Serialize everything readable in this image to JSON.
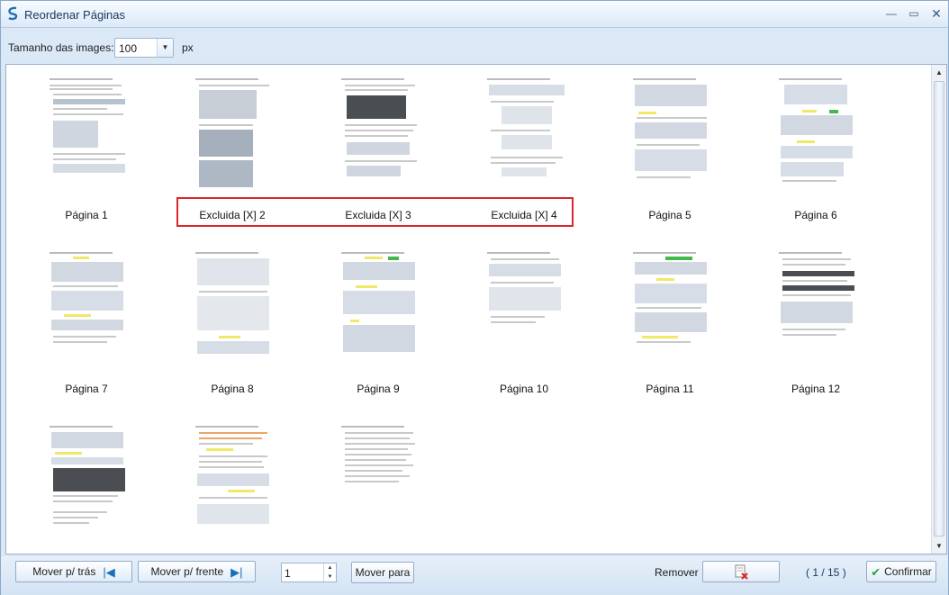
{
  "window": {
    "title": "Reordenar Páginas",
    "controls": {
      "minimize": "—",
      "maximize": "▭",
      "close": "✕"
    }
  },
  "toolbar": {
    "size_label": "Tamanho das images:",
    "size_value": "100",
    "size_unit": "px"
  },
  "pages": [
    {
      "label": "Página 1"
    },
    {
      "label": "Excluida [X] 2"
    },
    {
      "label": "Excluida [X] 3"
    },
    {
      "label": "Excluida [X] 4"
    },
    {
      "label": "Página 5"
    },
    {
      "label": "Página 6"
    },
    {
      "label": "Página 7"
    },
    {
      "label": "Página 8"
    },
    {
      "label": "Página 9"
    },
    {
      "label": "Página 10"
    },
    {
      "label": "Página 11"
    },
    {
      "label": "Página 12"
    },
    {
      "label": ""
    },
    {
      "label": ""
    },
    {
      "label": ""
    }
  ],
  "bottom": {
    "back_label": "Mover p/ trás",
    "fwd_label": "Mover p/ frente",
    "page_value": "1",
    "move_to_label": "Mover para",
    "remove_label": "Remover",
    "counter": "( 1 / 15 )",
    "confirm_label": "Confirmar"
  },
  "colors": {
    "highlight_border": "#d9272e",
    "accent": "#1a6fb8",
    "confirm": "#2aa43b"
  }
}
